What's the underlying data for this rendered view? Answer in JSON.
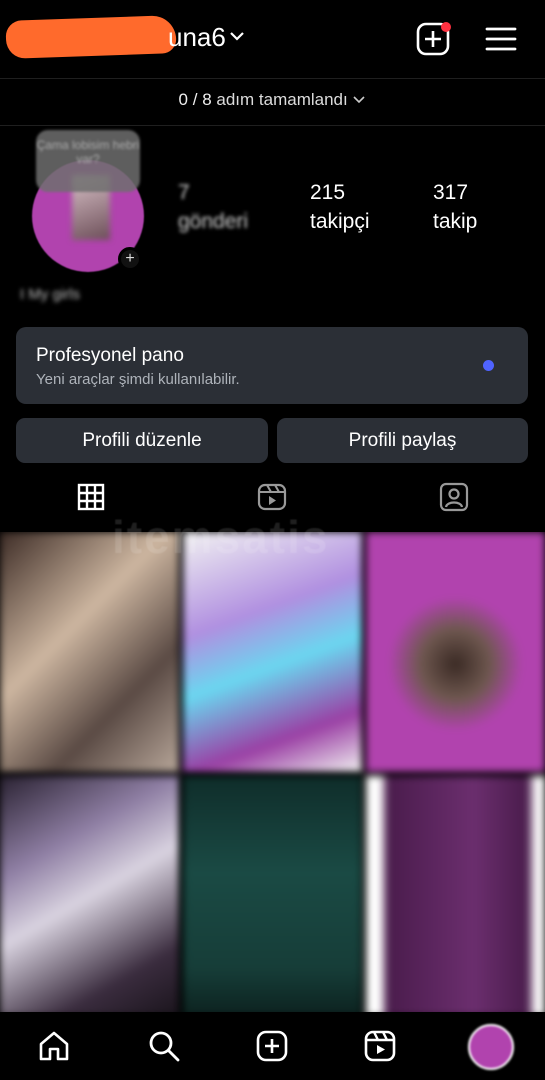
{
  "header": {
    "username_visible": "una6",
    "icons": [
      "chevron-down-icon",
      "create-post-icon",
      "menu-icon"
    ],
    "accent_notification": "#ff3040"
  },
  "onboarding": {
    "completed": "0",
    "sep": "/",
    "total": "8",
    "label": "adım tamamlandı"
  },
  "profile": {
    "note_text": "Çama lobisim hebri var?",
    "stats": [
      {
        "value": "7",
        "label": "gönderi"
      },
      {
        "value": "215",
        "label": "takipçi"
      },
      {
        "value": "317",
        "label": "takip"
      }
    ],
    "bio": "I My girls"
  },
  "pro_panel": {
    "title": "Profesyonel pano",
    "subtitle": "Yeni araçlar şimdi kullanılabilir.",
    "dot_color": "#4f63ff"
  },
  "buttons": {
    "edit": "Profili düzenle",
    "share": "Profili paylaş"
  },
  "tabs": [
    "grid-icon",
    "reels-icon",
    "tagged-icon"
  ],
  "watermark": "itemsatis",
  "bottom_nav": [
    "home-icon",
    "search-icon",
    "create-icon",
    "reels-icon",
    "profile-avatar"
  ]
}
